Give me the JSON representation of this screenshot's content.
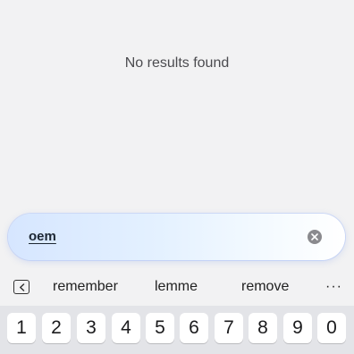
{
  "results": {
    "empty_message": "No results found"
  },
  "search": {
    "value": "oem"
  },
  "suggestions": {
    "items": [
      "remember",
      "lemme",
      "remove"
    ],
    "more": "···"
  },
  "keyboard": {
    "keys": [
      "1",
      "2",
      "3",
      "4",
      "5",
      "6",
      "7",
      "8",
      "9",
      "0"
    ]
  },
  "colors": {
    "background": "#f2f2f3",
    "search_gradient_start": "#d6e6ff",
    "keyboard_bg": "#e3e4e8"
  }
}
